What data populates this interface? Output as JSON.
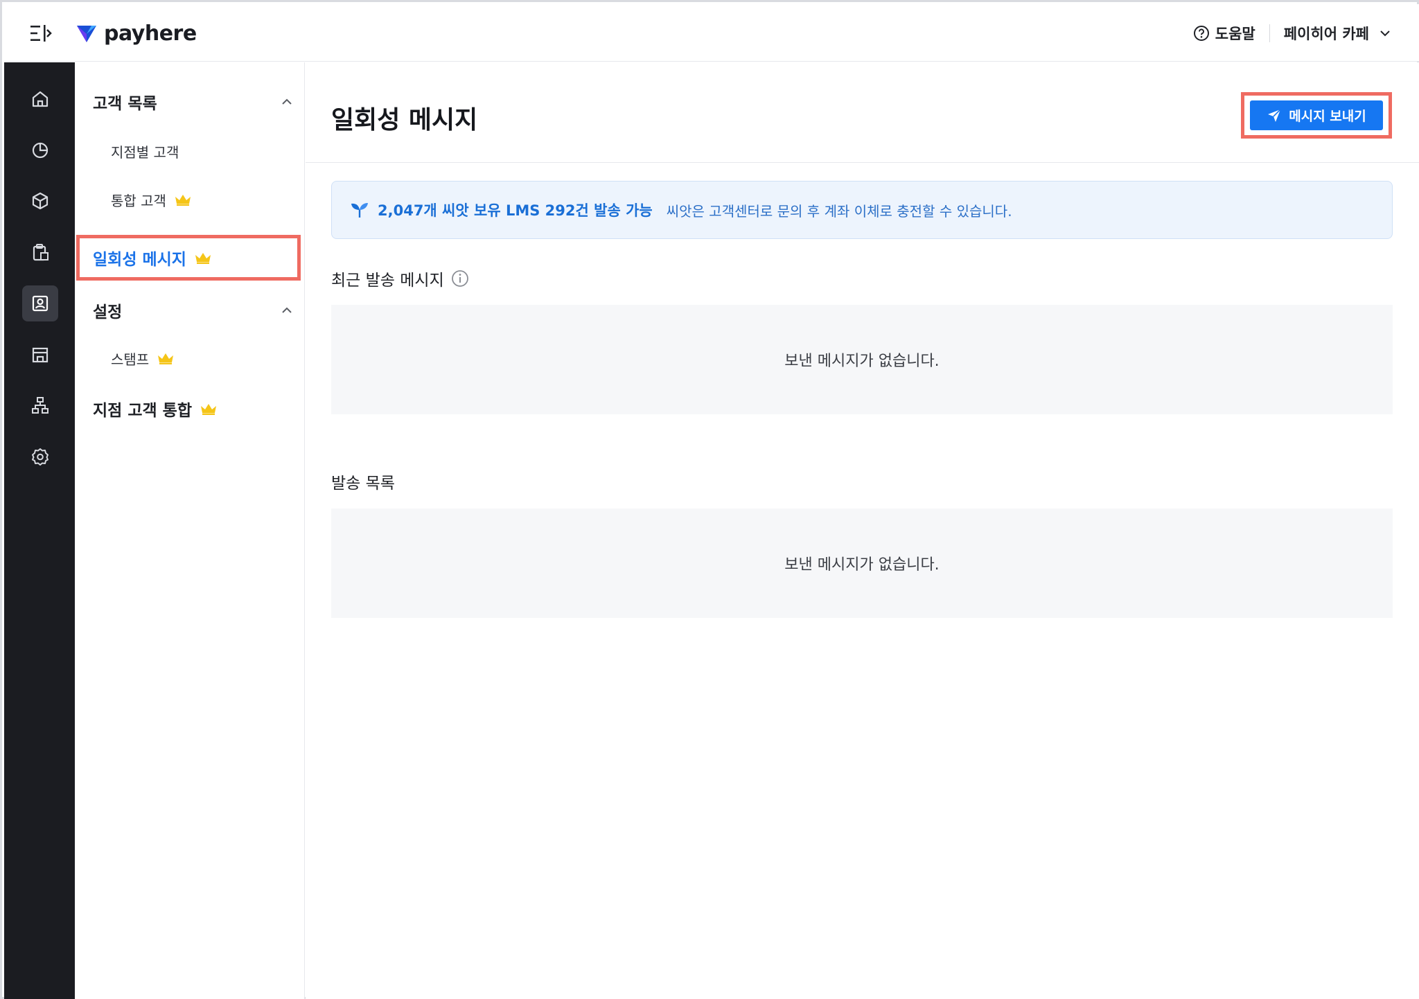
{
  "header": {
    "logo_text": "payhere",
    "help_label": "도움말",
    "store_name": "페이히어 카페"
  },
  "rail": {
    "items": [
      {
        "icon": "home-icon"
      },
      {
        "icon": "pie-chart-icon"
      },
      {
        "icon": "box-icon"
      },
      {
        "icon": "clipboard-icon"
      },
      {
        "icon": "customer-card-icon",
        "active": true
      },
      {
        "icon": "store-icon"
      },
      {
        "icon": "org-chart-icon"
      },
      {
        "icon": "gear-icon"
      }
    ]
  },
  "subnav": {
    "customer_list": "고객 목록",
    "branch_customers": "지점별 고객",
    "integrated_customers": "통합 고객",
    "one_time_message": "일회성 메시지",
    "settings": "설정",
    "stamp": "스탬프",
    "branch_customer_merge": "지점 고객 통합"
  },
  "main": {
    "page_title": "일회성 메시지",
    "send_button": "메시지 보내기",
    "notice": {
      "highlight": "2,047개 씨앗 보유 LMS 292건 발송 가능",
      "description": "씨앗은 고객센터로 문의 후 계좌 이체로 충전할 수 있습니다."
    },
    "recent_section": "최근 발송 메시지",
    "recent_empty": "보낸 메시지가 없습니다.",
    "list_section": "발송 목록",
    "list_empty": "보낸 메시지가 없습니다."
  },
  "colors": {
    "accent": "#1677f2",
    "highlight_outline": "#ef6b61",
    "crown": "#f5c518",
    "rail_bg": "#1b1c21"
  }
}
